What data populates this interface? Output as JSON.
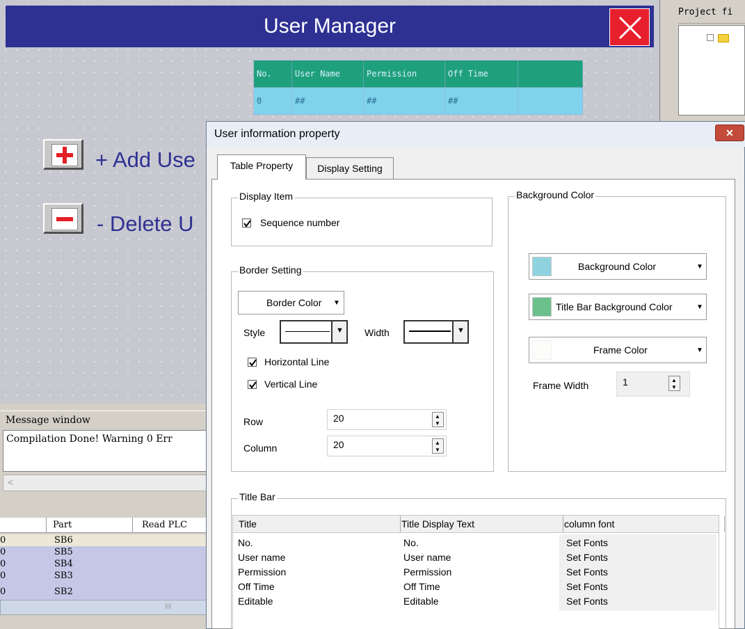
{
  "editor": {
    "header_title": "User Manager",
    "preview_table": {
      "headers": [
        "No.",
        "User Name",
        "Permission",
        "Off Time",
        ""
      ],
      "row": [
        "0",
        "##",
        "##",
        "##",
        ""
      ]
    },
    "add_label": "+ Add Use",
    "delete_label": "- Delete U"
  },
  "project_panel": {
    "title": "Project fi"
  },
  "message_window": {
    "title": "Message window",
    "text": "Compilation Done! Warning 0 Err"
  },
  "part_list": {
    "headers": [
      "Part",
      "Read PLC"
    ],
    "rows": [
      {
        "index": "0",
        "part": "SB6"
      },
      {
        "index": "0",
        "part": "SB5"
      },
      {
        "index": "0",
        "part": "SB4"
      },
      {
        "index": "0",
        "part": "SB3"
      },
      {
        "index": "0",
        "part": "SB2"
      }
    ],
    "scroll_glyph": "III"
  },
  "dialog": {
    "title": "User information property",
    "close_glyph": "✕",
    "tabs": [
      "Table Property",
      "Display Setting"
    ],
    "display_item": {
      "title": "Display Item",
      "sequence_label": "Sequence number",
      "sequence_checked": true
    },
    "border_setting": {
      "title": "Border Setting",
      "border_color_label": "Border Color",
      "border_color": "#ffffff",
      "style_label": "Style",
      "width_label": "Width",
      "horizontal_label": "Horizontal Line",
      "horizontal_checked": true,
      "vertical_label": "Vertical Line",
      "vertical_checked": true,
      "row_label": "Row",
      "row_value": "20",
      "column_label": "Column",
      "column_value": "20"
    },
    "background_color": {
      "title": "Background Color",
      "bg_label": "Background Color",
      "bg_color": "#8ed3df",
      "titlebar_label": "Title Bar Background Color",
      "titlebar_color": "#6cc08c",
      "frame_label": "Frame Color",
      "frame_color": "#fcfcfa",
      "frame_width_label": "Frame Width",
      "frame_width_value": "1"
    },
    "title_bar": {
      "title": "Title Bar",
      "columns": [
        "Title",
        "Title Display Text",
        "column font"
      ],
      "rows": [
        [
          "No.",
          "No.",
          "Set Fonts"
        ],
        [
          "User name",
          "User name",
          "Set Fonts"
        ],
        [
          "Permission",
          "Permission",
          "Set Fonts"
        ],
        [
          "Off Time",
          "Off Time",
          "Set Fonts"
        ],
        [
          "Editable",
          "Editable",
          "Set Fonts"
        ]
      ]
    }
  }
}
